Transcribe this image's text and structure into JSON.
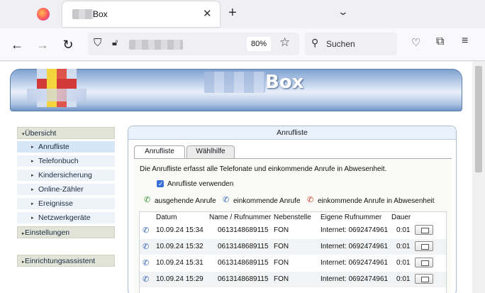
{
  "browser": {
    "tab_title": "Box",
    "zoom": "80%",
    "search_placeholder": "Suchen"
  },
  "header": {
    "brand": "Box"
  },
  "sidebar": {
    "items": [
      {
        "label": "Übersicht",
        "level": "main",
        "expanded": true
      },
      {
        "label": "Anrufliste",
        "level": "sub",
        "active": true
      },
      {
        "label": "Telefonbuch",
        "level": "sub"
      },
      {
        "label": "Kindersicherung",
        "level": "sub"
      },
      {
        "label": "Online-Zähler",
        "level": "sub"
      },
      {
        "label": "Ereignisse",
        "level": "sub"
      },
      {
        "label": "Netzwerkgeräte",
        "level": "sub"
      },
      {
        "label": "Einstellungen",
        "level": "main"
      },
      {
        "label": "Einrichtungsassistent",
        "level": "main"
      }
    ]
  },
  "panel": {
    "title": "Anrufliste",
    "tabs": [
      {
        "label": "Anrufliste",
        "active": true
      },
      {
        "label": "Wählhilfe",
        "active": false
      }
    ],
    "description": "Die Anrufliste erfasst alle Telefonate und einkommende Anrufe in Abwesenheit.",
    "checkbox_label": "Anrufliste verwenden",
    "checkbox_checked": true,
    "legend": {
      "outgoing": "ausgehende Anrufe",
      "incoming": "einkommende Anrufe",
      "missed": "einkommende Anrufe in Abwesenheit"
    }
  },
  "table": {
    "columns": [
      "Datum",
      "Name / Rufnummer",
      "Nebenstelle",
      "Eigene Rufnummer",
      "Dauer"
    ],
    "rows": [
      {
        "date": "10.09.24 15:34",
        "number": "0613148689115",
        "extension": "FON",
        "own_number": "Internet: 0692474961",
        "duration": "0:01"
      },
      {
        "date": "10.09.24 15:32",
        "number": "0613148689115",
        "extension": "FON",
        "own_number": "Internet: 0692474961",
        "duration": "0:01"
      },
      {
        "date": "10.09.24 15:31",
        "number": "0613148689115",
        "extension": "FON",
        "own_number": "Internet: 0692474961",
        "duration": "0:01"
      },
      {
        "date": "10.09.24 15:29",
        "number": "0613148689115",
        "extension": "FON",
        "own_number": "Internet: 0692474961",
        "duration": "0:01"
      }
    ]
  },
  "icons": {
    "outgoing": "phone-outgoing-icon",
    "incoming": "phone-incoming-icon",
    "missed": "phone-missed-icon",
    "phonebook": "phonebook-icon"
  },
  "colors": {
    "header_blue": "#7fa2cf",
    "sidebar_main": "#e2e4d8",
    "sidebar_sub": "#eef3f9",
    "outgoing_green": "#2d8d2d",
    "incoming_blue": "#2f62b8",
    "missed_red": "#d23a2a"
  }
}
